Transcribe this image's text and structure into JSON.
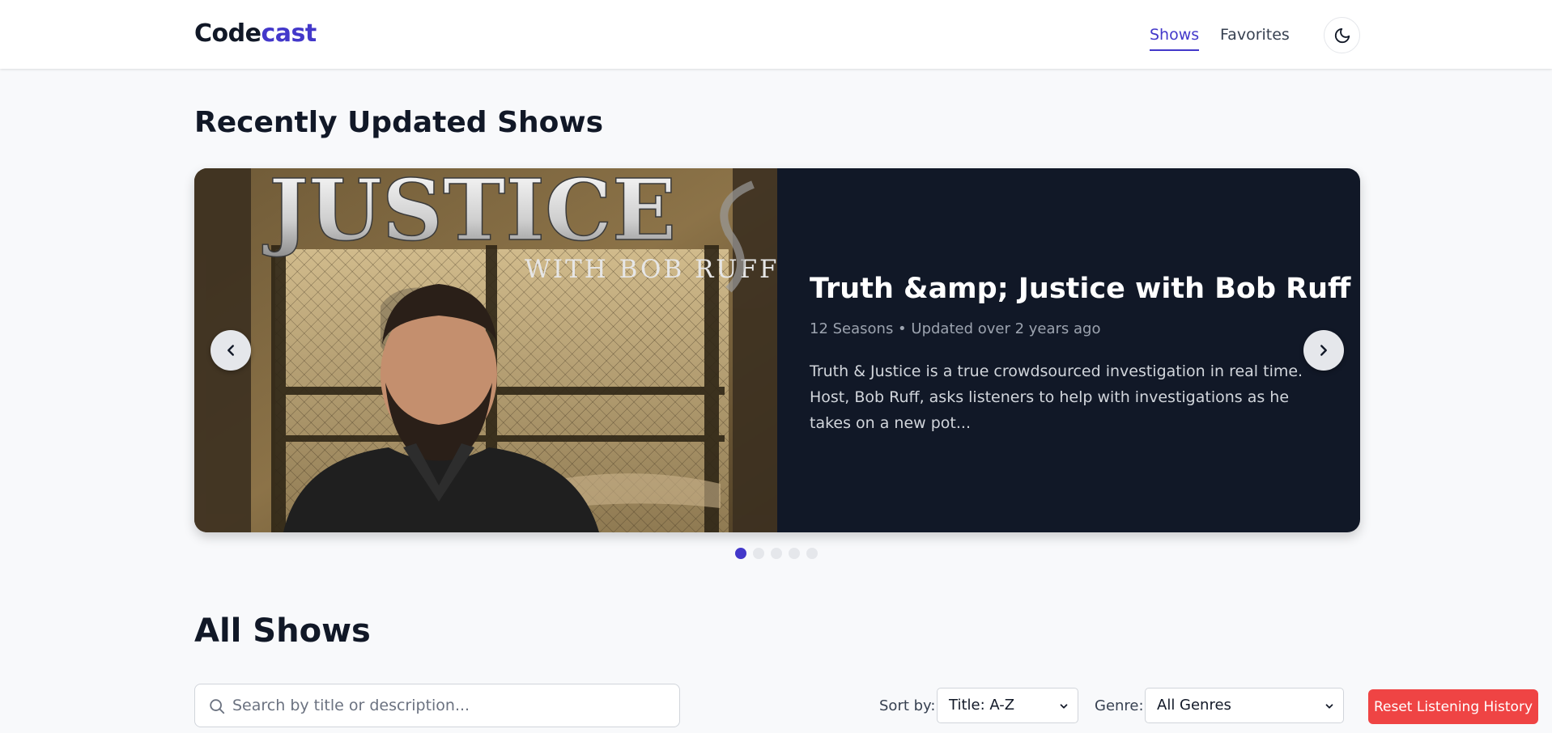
{
  "header": {
    "logo_part1": "Code",
    "logo_part2": "cast",
    "nav": [
      {
        "label": "Shows",
        "active": true
      },
      {
        "label": "Favorites",
        "active": false
      }
    ],
    "theme_toggle_icon": "moon-icon"
  },
  "recent": {
    "heading": "Recently Updated Shows",
    "slide": {
      "cover_text_main": "JUSTICE",
      "cover_text_sub": "WITH BOB RUFF",
      "title": "Truth &amp; Justice with Bob Ruff",
      "meta": "12 Seasons • Updated over 2 years ago",
      "description": "Truth & Justice is a true crowdsourced investigation in real time. Host, Bob Ruff, asks listeners to help with investigations as he takes on a new pot..."
    },
    "prev_icon": "chevron-left-icon",
    "next_icon": "chevron-right-icon",
    "dots": 5,
    "active_dot": 1
  },
  "all_shows": {
    "heading": "All Shows",
    "search_placeholder": "Search by title or description...",
    "sort_label": "Sort by:",
    "sort_value": "Title: A-Z",
    "genre_label": "Genre:",
    "genre_value": "All Genres",
    "reset_label": "Reset Listening History"
  },
  "colors": {
    "accent": "#4338ca",
    "danger": "#ef4444",
    "slide_bg": "#111827"
  }
}
